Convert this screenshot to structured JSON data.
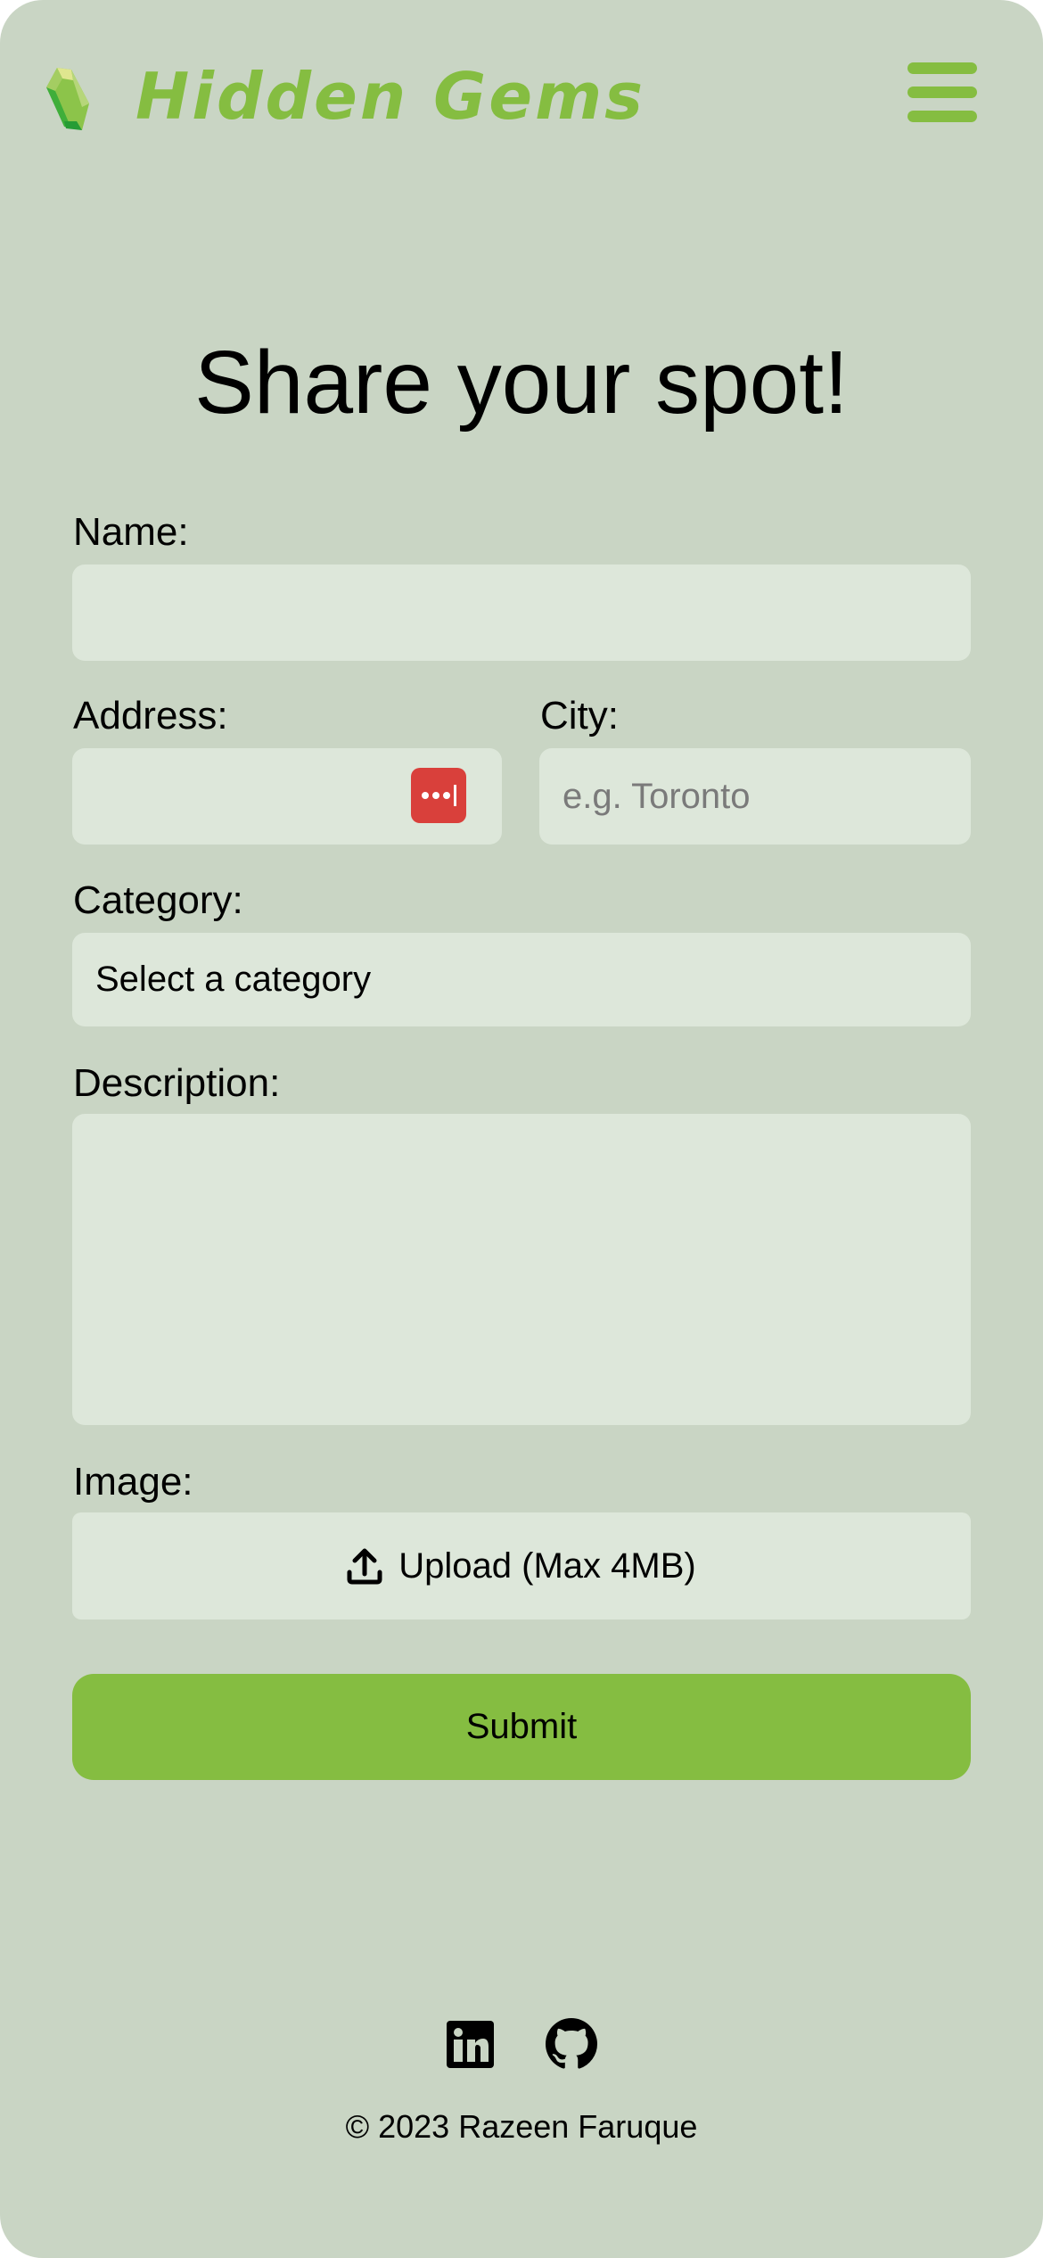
{
  "header": {
    "brand": "Hidden Gems",
    "logo_icon": "gem-icon",
    "menu_icon": "hamburger-menu-icon"
  },
  "form": {
    "title": "Share your spot!",
    "name": {
      "label": "Name:",
      "value": ""
    },
    "address": {
      "label": "Address:",
      "value": ""
    },
    "city": {
      "label": "City:",
      "placeholder": "e.g. Toronto"
    },
    "category": {
      "label": "Category:",
      "selected": "Select a category"
    },
    "description": {
      "label": "Description:",
      "value": ""
    },
    "image": {
      "label": "Image:",
      "upload_label": "Upload (Max 4MB)"
    },
    "submit_label": "Submit"
  },
  "footer": {
    "copyright": "© 2023 Razeen Faruque",
    "icons": [
      "linkedin-icon",
      "github-icon"
    ]
  },
  "colors": {
    "background": "#c9d5c4",
    "field": "#dde7da",
    "accent": "#85bd41",
    "password_manager": "#d9403b"
  }
}
